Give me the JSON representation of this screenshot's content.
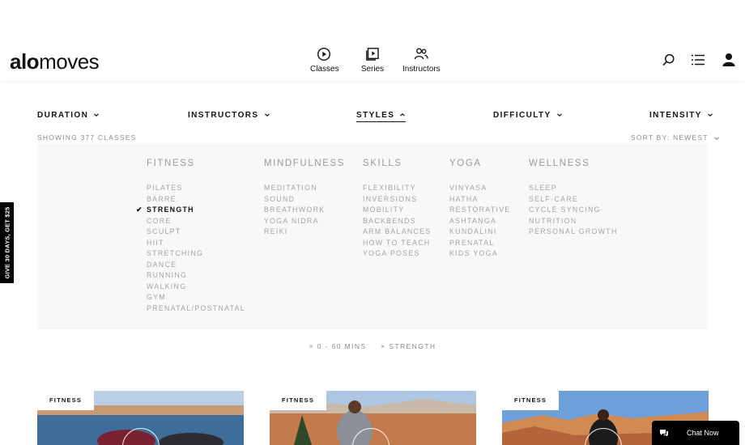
{
  "header": {
    "logo_bold": "alo",
    "logo_light": "moves",
    "nav": [
      {
        "label": "Classes",
        "icon": "play-circle-icon"
      },
      {
        "label": "Series",
        "icon": "play-stack-icon"
      },
      {
        "label": "Instructors",
        "icon": "people-icon"
      }
    ],
    "icons": [
      "search-icon",
      "menu-icon",
      "account-icon"
    ]
  },
  "filters": [
    {
      "label": "DURATION",
      "state": "collapsed"
    },
    {
      "label": "INSTRUCTORS",
      "state": "collapsed"
    },
    {
      "label": "STYLES",
      "state": "expanded"
    },
    {
      "label": "DIFFICULTY",
      "state": "collapsed"
    },
    {
      "label": "INTENSITY",
      "state": "collapsed"
    }
  ],
  "results": {
    "showing": "SHOWING 377 CLASSES",
    "sort": "SORT BY: NEWEST"
  },
  "styles_panel": {
    "columns": [
      {
        "heading": "FITNESS",
        "options": [
          "PILATES",
          "BARRE",
          "STRENGTH",
          "CORE",
          "SCULPT",
          "HIIT",
          "STRETCHING",
          "DANCE",
          "RUNNING",
          "WALKING",
          "GYM",
          "PRENATAL/POSTNATAL"
        ]
      },
      {
        "heading": "MINDFULNESS",
        "options": [
          "MEDITATION",
          "SOUND",
          "BREATHWORK",
          "YOGA NIDRA",
          "REIKI"
        ]
      },
      {
        "heading": "SKILLS",
        "options": [
          "FLEXIBILITY",
          "INVERSIONS",
          "MOBILITY",
          "BACKBENDS",
          "ARM BALANCES",
          "HOW TO TEACH",
          "YOGA POSES"
        ]
      },
      {
        "heading": "YOGA",
        "options": [
          "VINYASA",
          "HATHA",
          "RESTORATIVE",
          "ASHTANGA",
          "KUNDALINI",
          "PRENATAL",
          "KIDS YOGA"
        ]
      },
      {
        "heading": "WELLNESS",
        "options": [
          "SLEEP",
          "SELF-CARE",
          "CYCLE SYNCING",
          "NUTRITION",
          "PERSONAL GROWTH"
        ]
      }
    ],
    "selected": "STRENGTH",
    "check_glyph": "✔"
  },
  "active_filters": [
    "× 0 - 60 MINS",
    "× STRENGTH"
  ],
  "promo": {
    "label": "GIVE 30 DAYS, GET $25"
  },
  "cards": [
    {
      "badge": "FITNESS"
    },
    {
      "badge": "FITNESS"
    },
    {
      "badge": "FITNESS"
    }
  ],
  "chat": {
    "label": "Chat Now",
    "icon": "chat-bubbles-icon"
  },
  "colors": {
    "accent": "#111111",
    "muted": "#a4a4a4",
    "panel": "#f8f8f8"
  }
}
